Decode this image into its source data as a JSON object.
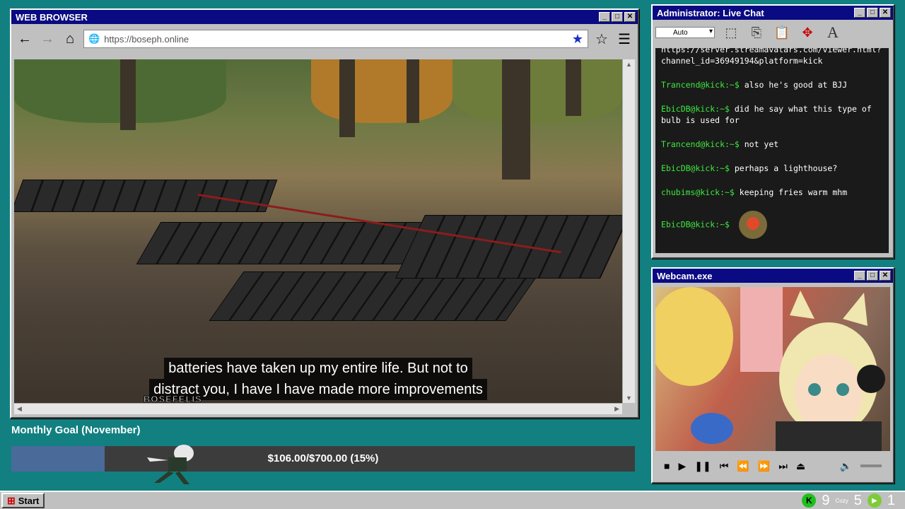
{
  "browser": {
    "title": "WEB BROWSER",
    "url": "https://boseph.online",
    "buttons": {
      "min": "_",
      "max": "□",
      "close": "✕"
    },
    "subtitles": [
      "batteries have taken up my entire life. But not to",
      "distract you, I have I have made more improvements"
    ],
    "watermark": "BOSEFELIS"
  },
  "chat": {
    "title": "Administrator: Live Chat",
    "font_select": "Auto",
    "messages": [
      {
        "user": "",
        "text": "https://server.streamavatars.com/viewer.html?channel_id=36949194&platform=kick"
      },
      {
        "user": "Trancend@kick:~$",
        "text": "also he's good at BJJ"
      },
      {
        "user": "EbicDB@kick:~$",
        "text": "did he say what this type of bulb is used for"
      },
      {
        "user": "Trancend@kick:~$",
        "text": "not yet"
      },
      {
        "user": "EbicDB@kick:~$",
        "text": "perhaps a lighthouse?"
      },
      {
        "user": "chubims@kick:~$",
        "text": "keeping fries warm mhm"
      },
      {
        "user": "EbicDB@kick:~$",
        "text": ""
      }
    ]
  },
  "webcam": {
    "title": "Webcam.exe"
  },
  "goal": {
    "title": "Monthly Goal (November)",
    "text": "$106.00/$700.00 (15%)",
    "progress": 0.15
  },
  "taskbar": {
    "start_label": "Start",
    "tray": {
      "kick_count": "9",
      "cozy_label": "Cozy",
      "cozy_count": "5",
      "play_count": "1"
    }
  }
}
